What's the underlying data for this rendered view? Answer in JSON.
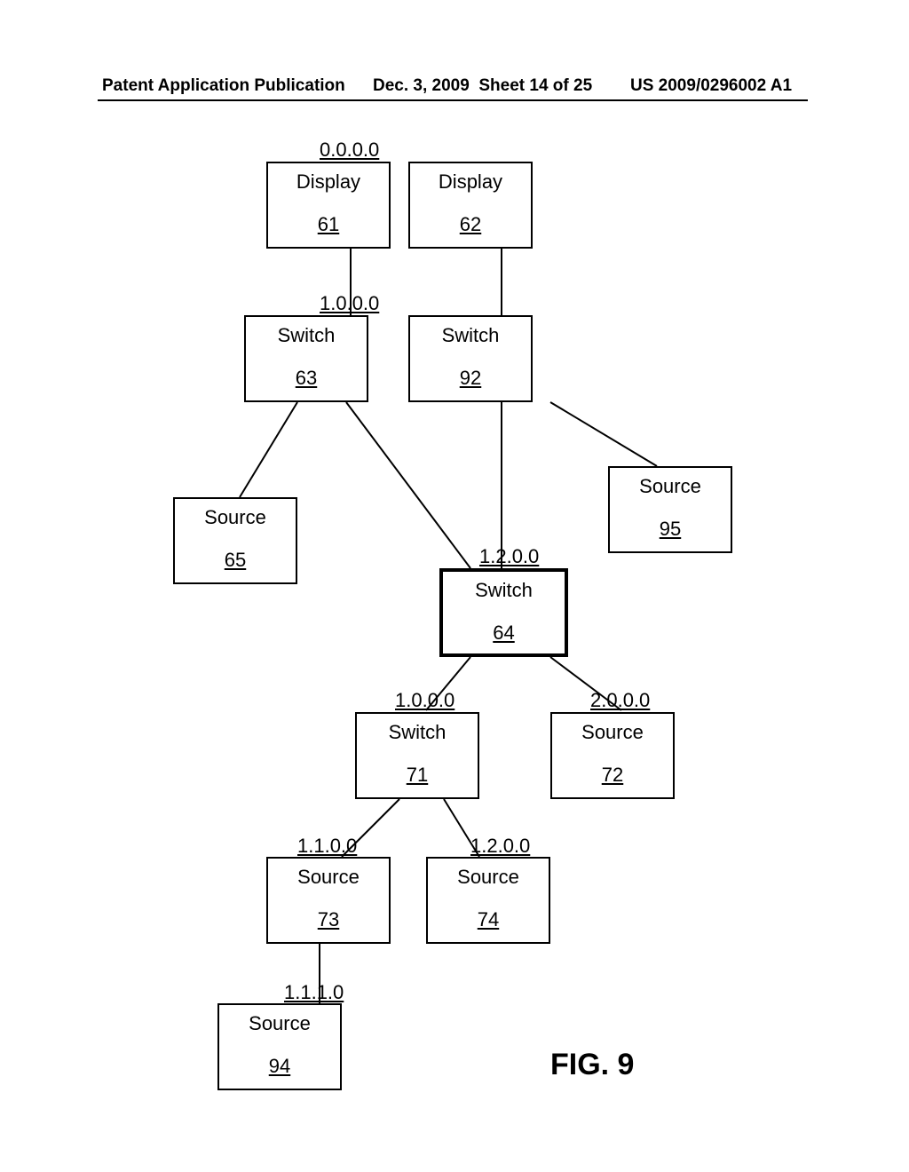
{
  "header": {
    "left": "Patent Application Publication",
    "mid_date": "Dec. 3, 2009",
    "mid_sheet": "Sheet 14 of 25",
    "right": "US 2009/0296002 A1"
  },
  "figure_label": "FIG. 9",
  "nodes": {
    "n61": {
      "label": "Display",
      "ref": "61",
      "addr": "0.0.0.0"
    },
    "n62": {
      "label": "Display",
      "ref": "62"
    },
    "n63": {
      "label": "Switch",
      "ref": "63",
      "addr": "1.0.0.0"
    },
    "n92": {
      "label": "Switch",
      "ref": "92"
    },
    "n65": {
      "label": "Source",
      "ref": "65"
    },
    "n95": {
      "label": "Source",
      "ref": "95"
    },
    "n64": {
      "label": "Switch",
      "ref": "64",
      "addr": "1.2.0.0"
    },
    "n71": {
      "label": "Switch",
      "ref": "71",
      "addr": "1.0.0.0"
    },
    "n72": {
      "label": "Source",
      "ref": "72",
      "addr": "2.0.0.0"
    },
    "n73": {
      "label": "Source",
      "ref": "73",
      "addr": "1.1.0.0"
    },
    "n74": {
      "label": "Source",
      "ref": "74",
      "addr": "1.2.0.0"
    },
    "n94": {
      "label": "Source",
      "ref": "94",
      "addr": "1.1.1.0"
    }
  },
  "diagram": {
    "description": "Hierarchical network topology tree with addressed nodes",
    "edges": [
      [
        "61",
        "63"
      ],
      [
        "62",
        "92"
      ],
      [
        "63",
        "65"
      ],
      [
        "63",
        "64"
      ],
      [
        "92",
        "64"
      ],
      [
        "92",
        "95"
      ],
      [
        "64",
        "71"
      ],
      [
        "64",
        "72"
      ],
      [
        "71",
        "73"
      ],
      [
        "71",
        "74"
      ],
      [
        "73",
        "94"
      ]
    ]
  }
}
